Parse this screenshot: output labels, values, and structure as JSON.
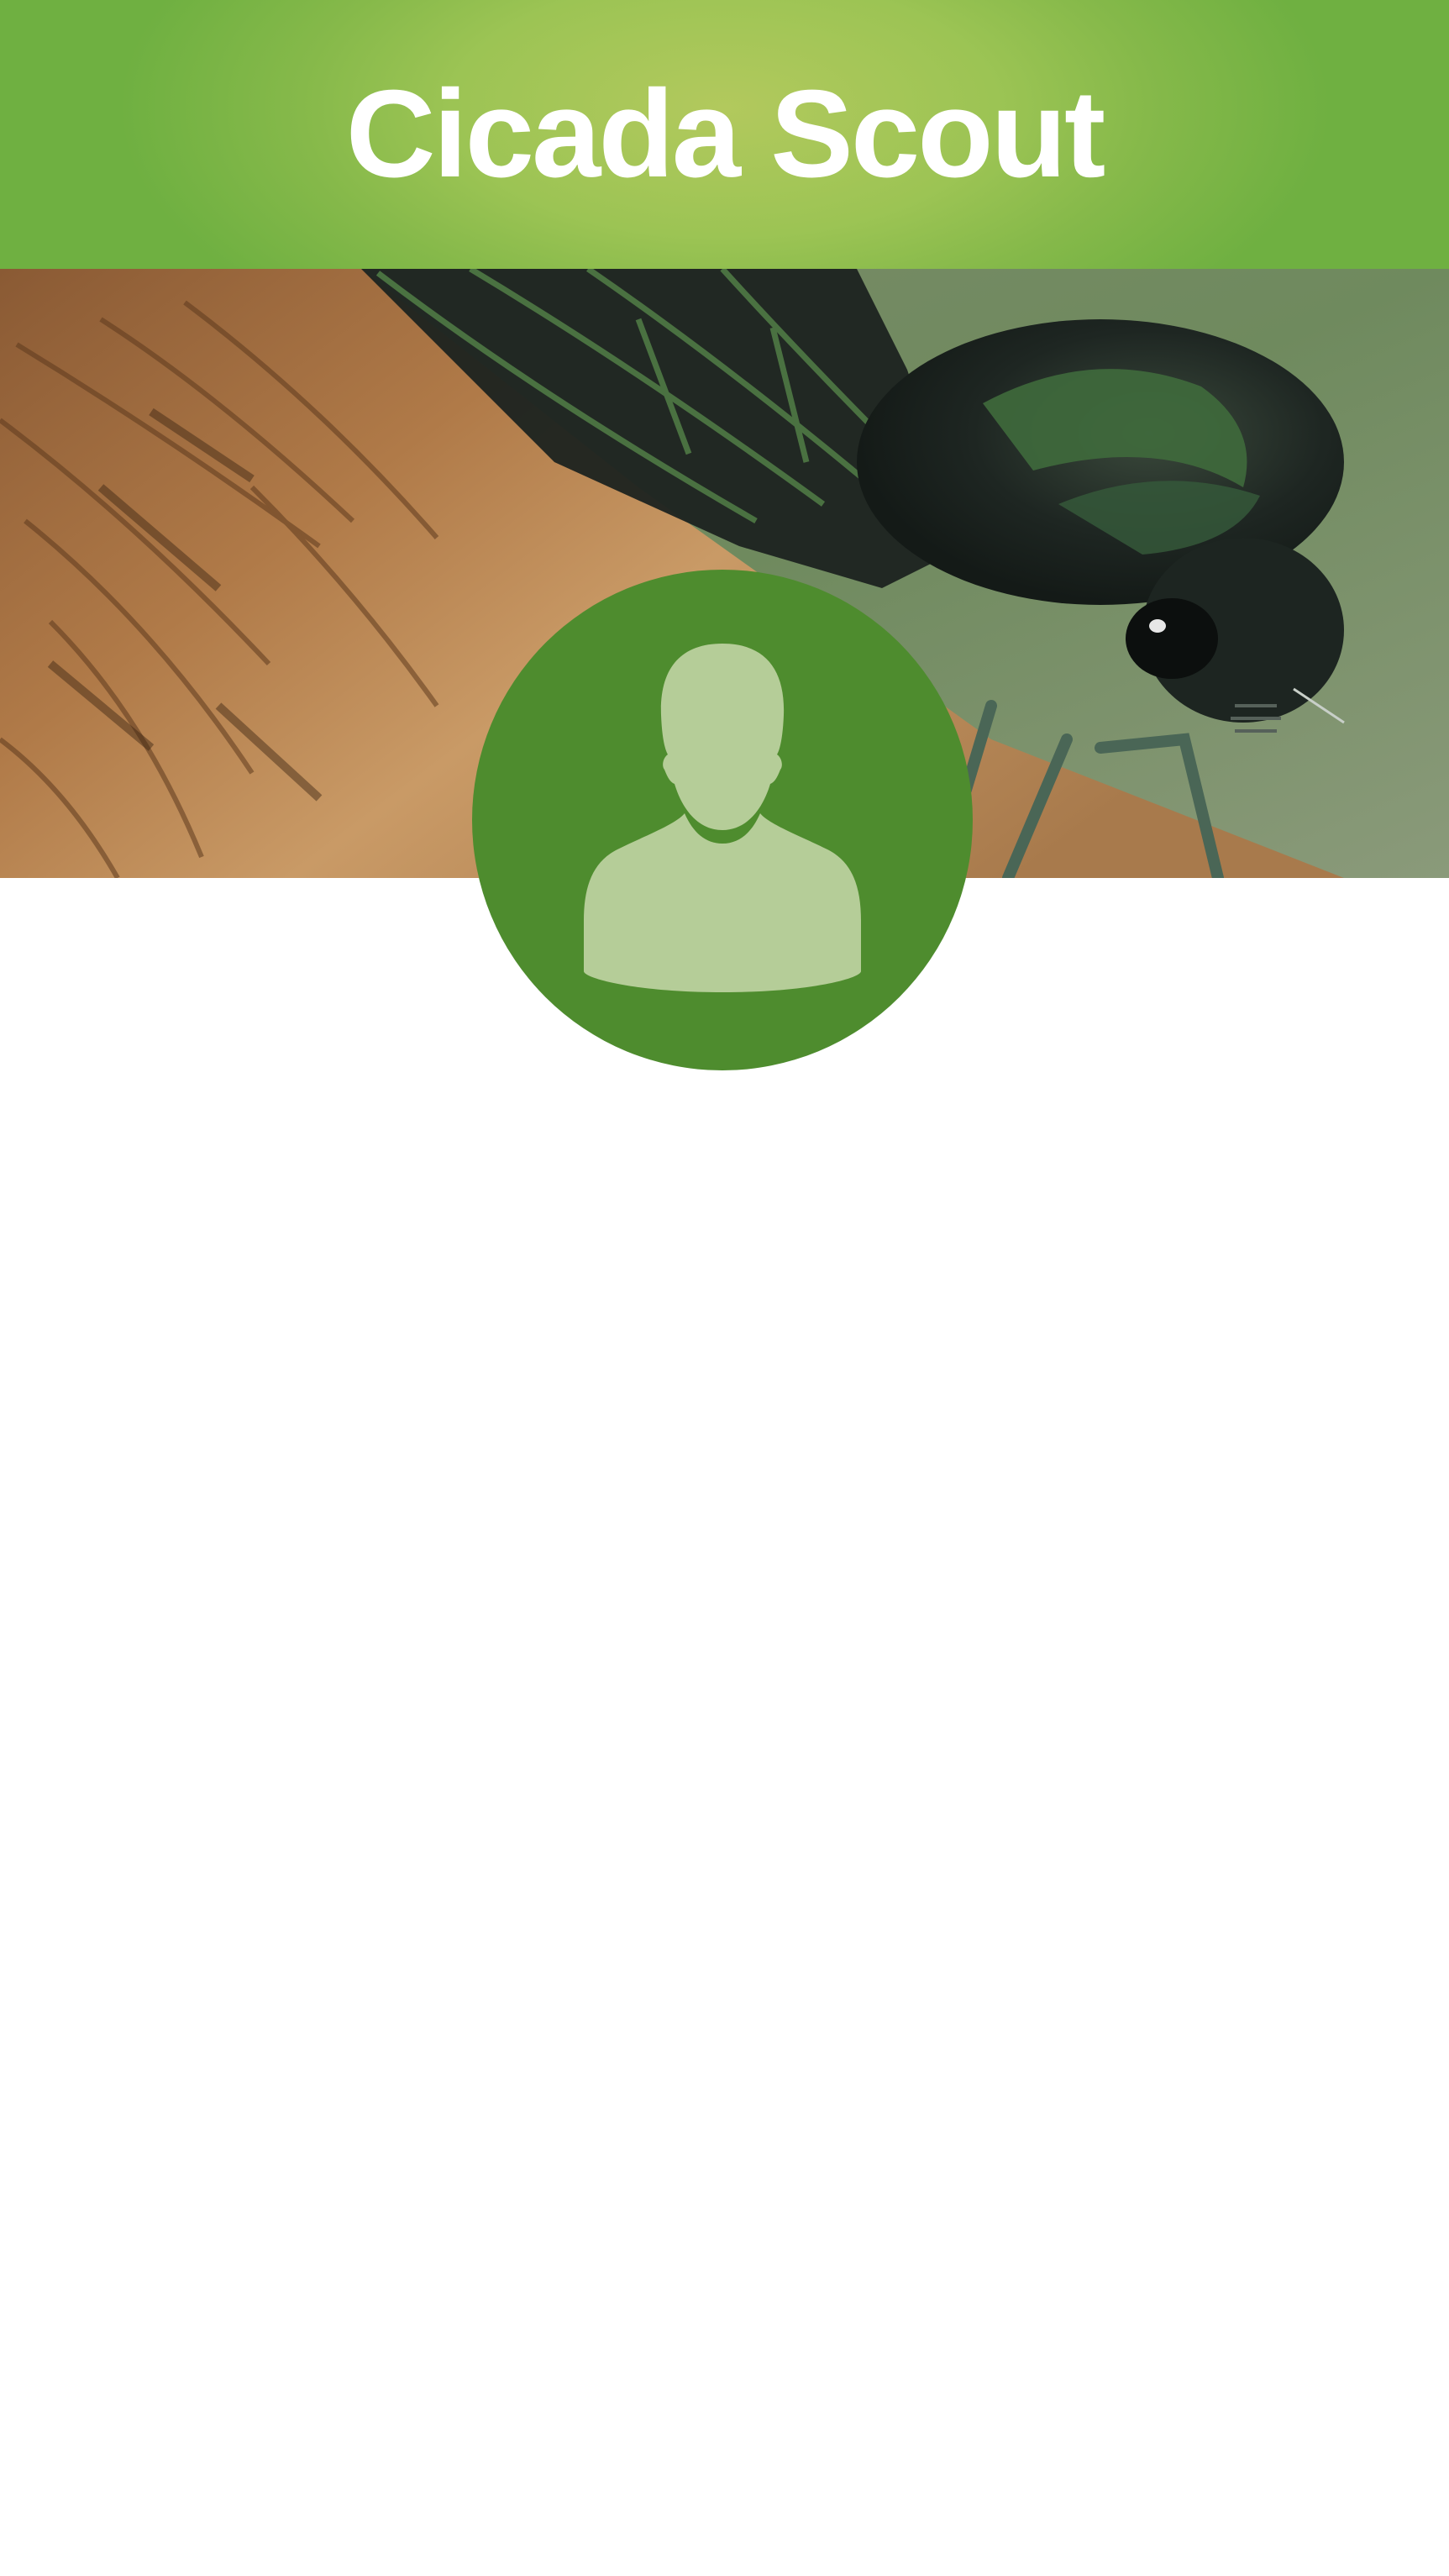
{
  "app": {
    "title": "Cicada Scout"
  },
  "hero": {
    "image": "cicada-on-wood-photo"
  },
  "profile": {
    "avatar_icon": "user-silhouette-icon"
  },
  "colors": {
    "header_green": "#7bb545",
    "header_highlight": "#b2c95d",
    "avatar_bg": "#4e8c2e",
    "avatar_figure": "#b5cd98"
  }
}
